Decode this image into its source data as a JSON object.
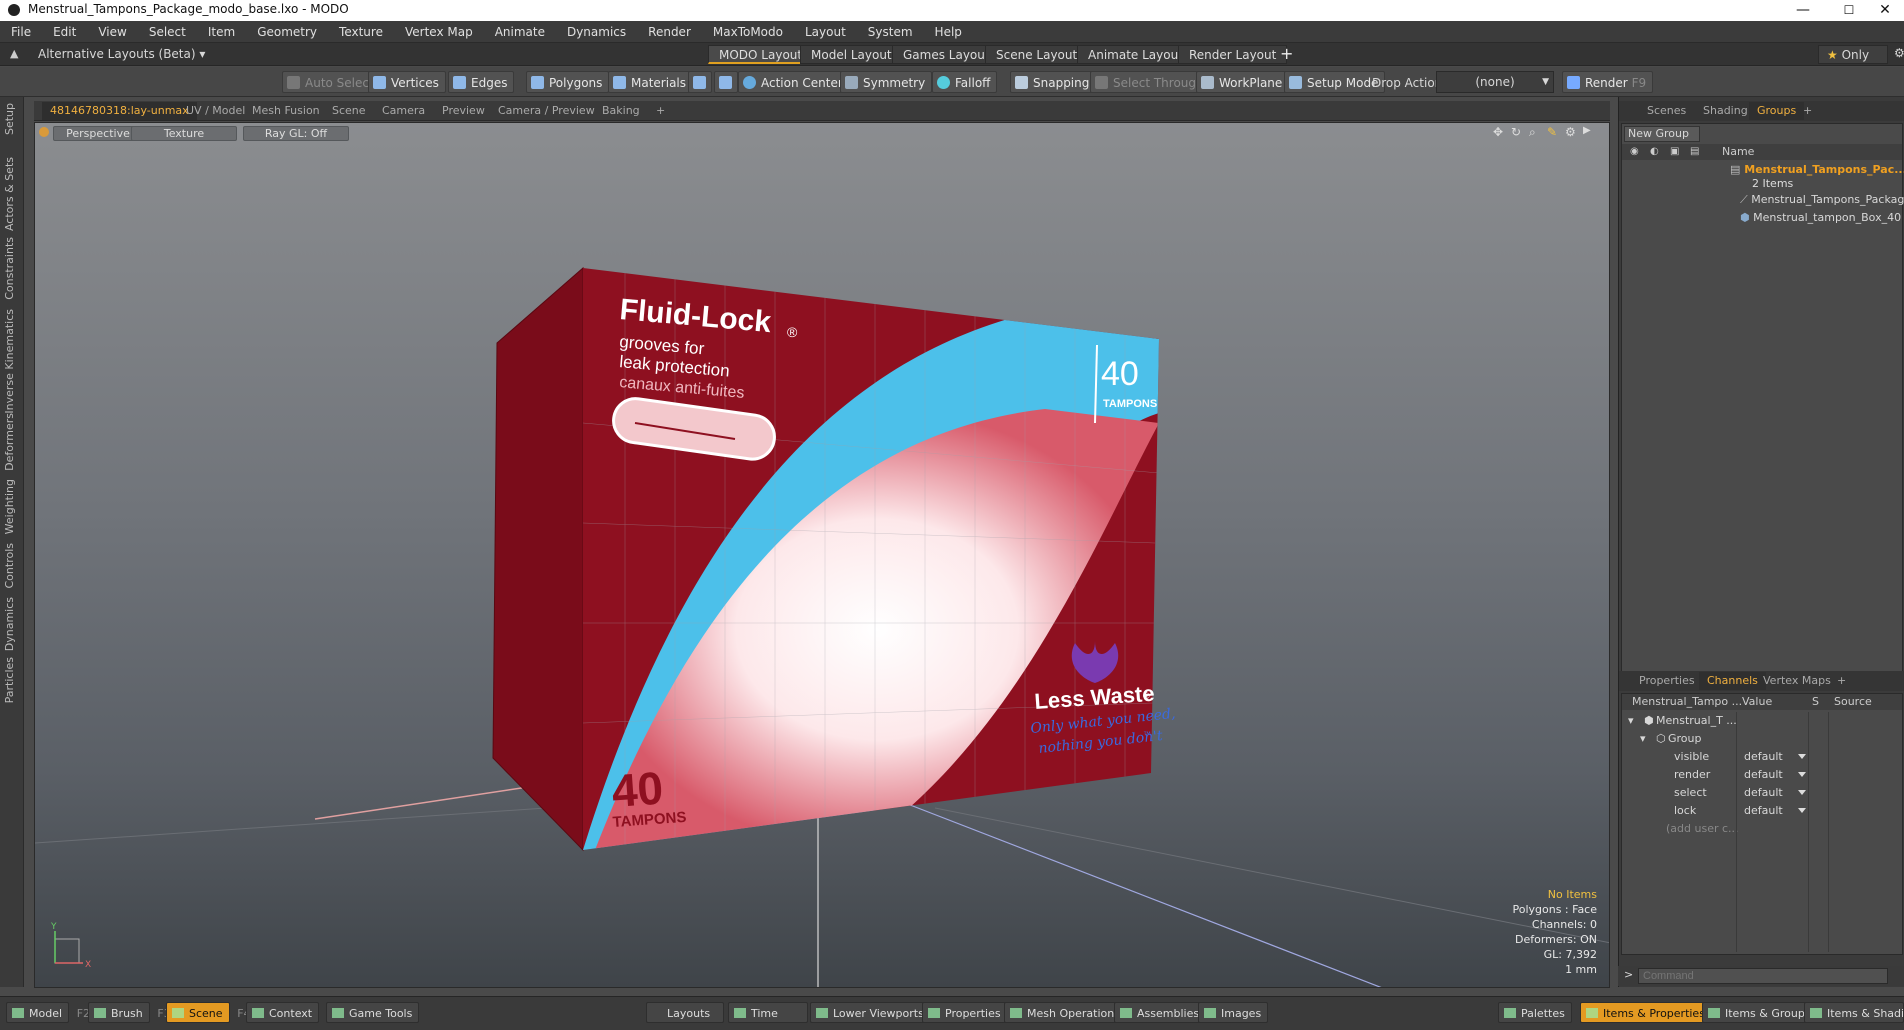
{
  "window": {
    "title": "Menstrual_Tampons_Package_modo_base.lxo - MODO",
    "minimize": "—",
    "maximize": "☐",
    "close": "✕"
  },
  "menu": [
    "File",
    "Edit",
    "View",
    "Select",
    "Item",
    "Geometry",
    "Texture",
    "Vertex Map",
    "Animate",
    "Dynamics",
    "Render",
    "MaxToModo",
    "Layout",
    "System",
    "Help"
  ],
  "layouts": {
    "alt_label": "Alternative Layouts (Beta)",
    "tabs": [
      "MODO Layout",
      "Model Layout",
      "Games Layout",
      "Scene Layout",
      "Animate Layout",
      "Render Layout"
    ],
    "active": "MODO Layout",
    "add": "+",
    "only": "Only"
  },
  "toolbar": {
    "auto_select": "Auto Select",
    "vertices": "Vertices",
    "edges": "Edges",
    "polygons": "Polygons",
    "materials": "Materials",
    "action_center": "Action Center",
    "symmetry": "Symmetry",
    "falloff": "Falloff",
    "snapping": "Snapping",
    "select_through": "Select Through",
    "workplane": "WorkPlane",
    "setup_mode": "Setup Mode",
    "drop_action": "Drop Action",
    "drop_value": "(none)",
    "render": "Render",
    "render_key": "F9"
  },
  "viewport_tabs": [
    "48146780318:lay-unmax",
    "UV / Model",
    "Mesh Fusion",
    "Scene",
    "Camera",
    "Preview",
    "Camera / Preview",
    "Baking"
  ],
  "viewport_tab_add": "+",
  "viewport": {
    "view": "Perspective",
    "shading": "Texture",
    "raygl": "Ray GL: Off",
    "info": {
      "items": "No Items",
      "polygons": "Polygons : Face",
      "channels": "Channels: 0",
      "deformers": "Deformers: ON",
      "gl": "GL: 7,392",
      "unit": "1 mm"
    },
    "axis_y": "Y",
    "axis_x": "X"
  },
  "package": {
    "brand": "Fluid-Lock",
    "brand_mark": "®",
    "line1": "grooves for",
    "line2": "leak protection",
    "line3": "canaux anti-fuites",
    "count_top": "40",
    "count_top_label": "TAMPONS",
    "count_bottom": "40",
    "count_bottom_label": "TAMPONS",
    "less_waste": "Less Waste",
    "less_waste_mark": "®",
    "tagline1": "Only what you need,",
    "tagline2": "nothing you don't",
    "tagline_mark": "™"
  },
  "left_strip": [
    "Setup",
    "Actors & Sets",
    "Constraints",
    "Inverse Kinematics",
    "Deformers",
    "Weighting",
    "Controls",
    "Dynamics",
    "Particles"
  ],
  "right_top": {
    "tabs": [
      "Scenes",
      "Shading",
      "Groups"
    ],
    "active": "Groups",
    "add": "+",
    "new_group": "New Group",
    "col_name": "Name",
    "group_name": "Menstrual_Tampons_Pac...",
    "group_count": "2 Items",
    "children": [
      "Menstrual_Tampons_Package",
      "Menstrual_tampon_Box_40"
    ]
  },
  "right_bottom": {
    "tabs": [
      "Properties",
      "Channels",
      "Vertex Maps"
    ],
    "active": "Channels",
    "add": "+",
    "cols": [
      "Menstrual_Tampo ...",
      "Value",
      "S",
      "Source"
    ],
    "root": "Menstrual_T ...",
    "group": "Group",
    "channels": [
      {
        "name": "visible",
        "value": "default"
      },
      {
        "name": "render",
        "value": "default"
      },
      {
        "name": "select",
        "value": "default"
      },
      {
        "name": "lock",
        "value": "default"
      }
    ],
    "add_user": "(add user c..."
  },
  "command": {
    "prompt": ">",
    "placeholder": "Command"
  },
  "bottom": {
    "left": [
      {
        "label": "Model",
        "key": "F2"
      },
      {
        "label": "Brush",
        "key": "F3"
      },
      {
        "label": "Scene",
        "key": "F4"
      },
      {
        "label": "Context",
        "key": ""
      },
      {
        "label": "Game Tools",
        "key": ""
      }
    ],
    "active": "Scene",
    "center": [
      "Layouts",
      "Time",
      "Lower Viewports",
      "Properties",
      "Mesh Operations",
      "Assemblies",
      "Images"
    ],
    "right": [
      "Palettes",
      "Items & Properties",
      "Items & Groups",
      "Items & Shading"
    ],
    "right_active": "Items & Properties"
  }
}
